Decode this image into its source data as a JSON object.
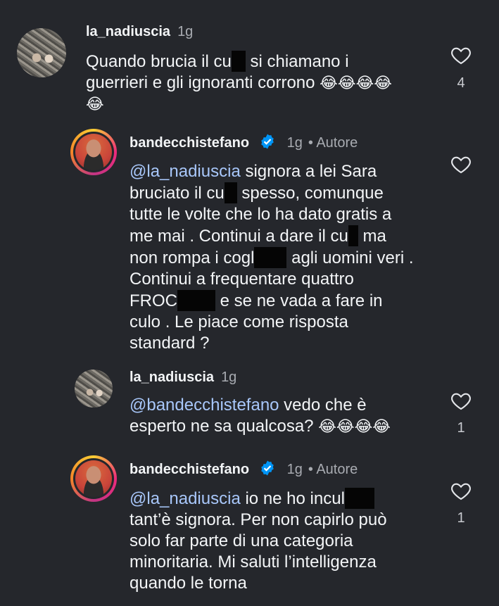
{
  "comments": [
    {
      "username": "la_nadiuscia",
      "time": "1g",
      "text_1": "Quando brucia il cu",
      "text_2": " si chiamano i",
      "text_3": "guerrieri e gli ignoranti corrono ",
      "emoji_line": "😂😂😂😂",
      "emoji_wrap": "😂",
      "likes": "4"
    },
    {
      "username": "bandecchistefano",
      "time": "1g",
      "author_label": "• Autore",
      "mention": "@la_nadiuscia",
      "t1": " signora a lei Sara",
      "t2a": "bruciato il cu",
      "t2b": " spesso, comunque",
      "t3": "tutte le volte che lo ha dato gratis a",
      "t4a": "me mai . Continui a dare il cu",
      "t4b": " ma",
      "t5a": "non rompa i cogl",
      "t5b": " agli uomini veri .",
      "t6": "Continui a frequentare quattro",
      "t7a": "FROC",
      "t7b": " e se ne vada a fare in",
      "t8": "culo . Le piace come risposta",
      "t9": "standard ?"
    },
    {
      "username": "la_nadiuscia",
      "time": "1g",
      "mention": "@bandecchistefano",
      "t1": "  vedo che è",
      "t2": "esperto ne sa qualcosa? ",
      "emoji": "😂😂😂😂",
      "likes": "1"
    },
    {
      "username": "bandecchistefano",
      "time": "1g",
      "author_label": "• Autore",
      "mention": "@la_nadiuscia",
      "t1": " io ne ho incul",
      "t2": "tant’è signora. Per non capirlo può",
      "t3": "solo far parte di una categoria",
      "t4": "minoritaria. Mi saluti l’intelligenza",
      "t5": "quando le torna",
      "likes": "1"
    }
  ],
  "colors": {
    "background": "#25272c",
    "mention": "#a8c7fa",
    "verified": "#0095f6"
  }
}
